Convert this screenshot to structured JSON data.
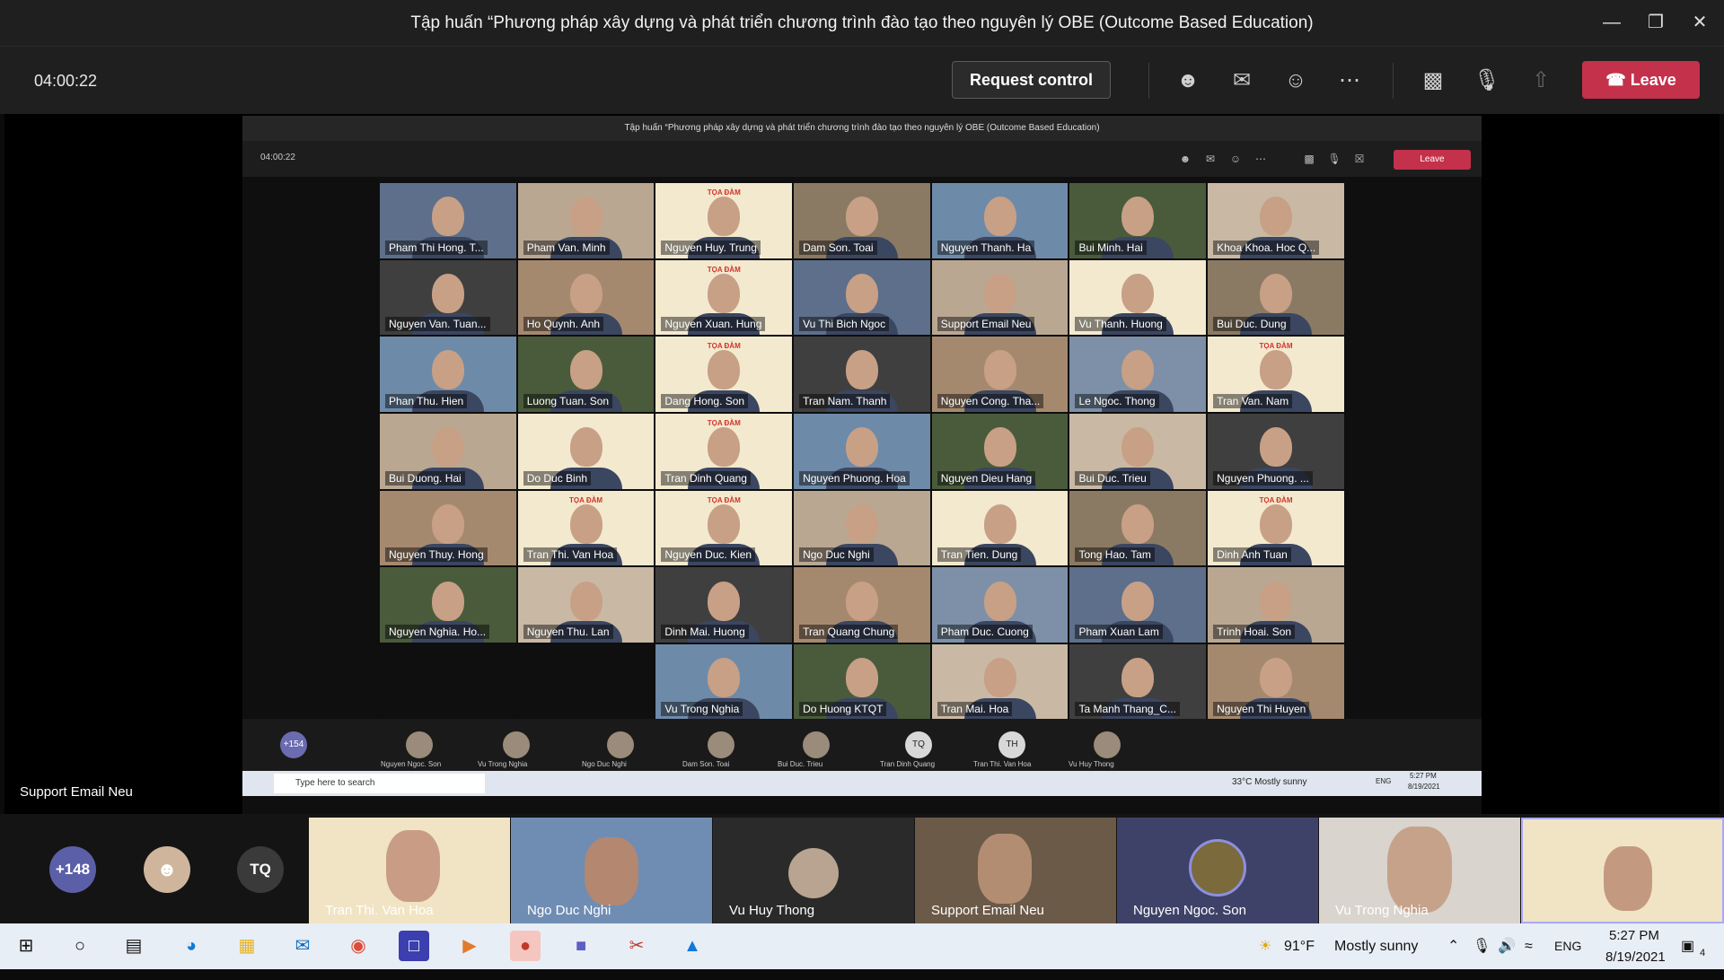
{
  "window": {
    "title": "Tập huấn “Phương pháp xây dựng và phát triển chương trình đào tạo theo nguyên lý OBE (Outcome Based Education)"
  },
  "toolbar": {
    "timer": "04:00:22",
    "request_control": "Request control",
    "leave": "Leave"
  },
  "shared": {
    "title": "Tập huấn “Phương pháp xây dựng và phát triển chương trình đào tạo theo nguyên lý OBE (Outcome Based Education)",
    "timer": "04:00:22",
    "leave": "Leave",
    "grid": [
      "Pham Thi Hong. T...",
      "Pham Van. Minh",
      "Nguyen Huy. Trung",
      "Dam Son. Toai",
      "Nguyen Thanh. Ha",
      "Bui Minh. Hai",
      "Khoa Khoa. Hoc Q...",
      "Nguyen Van. Tuan...",
      "Ho Quynh. Anh",
      "Nguyen Xuan. Hung",
      "Vu Thi Bich Ngoc",
      "Support Email Neu",
      "Vu Thanh. Huong",
      "Bui Duc. Dung",
      "Phan Thu. Hien",
      "Luong Tuan. Son",
      "Dang Hong. Son",
      "Tran Nam. Thanh",
      "Nguyen Cong. Tha...",
      "Le Ngoc. Thong",
      "Tran Van. Nam",
      "Bui Duong. Hai",
      "Do Duc Binh",
      "Tran Dinh Quang",
      "Nguyen Phuong. Hoa",
      "Nguyen Dieu Hang",
      "Bui Duc. Trieu",
      "Nguyen Phuong. ...",
      "Nguyen Thuy. Hong",
      "Tran Thi. Van Hoa",
      "Nguyen Duc. Kien",
      "Ngo Duc Nghi",
      "Tran Tien. Dung",
      "Tong Hao. Tam",
      "Dinh Anh Tuan",
      "Nguyen Nghia. Ho...",
      "Nguyen Thu. Lan",
      "Dinh Mai. Huong",
      "Tran Quang Chung",
      "Pham Duc. Cuong",
      "Pham Xuan Lam",
      "Trinh Hoai. Son",
      "",
      "",
      "Vu Trong Nghia",
      "Do Huong KTQT",
      "Tran Mai. Hoa",
      "Ta Manh Thang_C...",
      "Nguyen Thi Huyen"
    ],
    "banner_text": "TỌA ĐÀM",
    "strip": {
      "count": "+154",
      "labels": [
        "Nguyen Ngoc. Son",
        "Vu Trong Nghia",
        "Ngo Duc Nghi",
        "Dam Son. Toai",
        "Bui Duc. Trieu",
        "Tran Dinh Quang",
        "Tran Thi. Van Hoa",
        "Vu Huy Thong"
      ],
      "initials_tq": "TQ",
      "initials_th": "TH"
    },
    "taskbar": {
      "search": "Type here to search",
      "weather": "33°C  Mostly sunny",
      "lang": "ENG",
      "time": "5:27 PM",
      "date": "8/19/2021"
    }
  },
  "presenter_label": "Support Email Neu",
  "bottom_strip": {
    "count": "+148",
    "initials": "TQ",
    "tiles": [
      "Tran Thi. Van Hoa",
      "Ngo Duc Nghi",
      "Vu Huy Thong",
      "Support Email Neu",
      "Nguyen Ngoc. Son",
      "Vu Trong Nghia"
    ]
  },
  "taskbar": {
    "weather_temp": "91°F",
    "weather_text": "Mostly sunny",
    "lang": "ENG",
    "time": "5:27 PM",
    "date": "8/19/2021",
    "notifications": "4"
  },
  "colors": {
    "leave": "#c4314b",
    "accent": "#6264a7"
  }
}
